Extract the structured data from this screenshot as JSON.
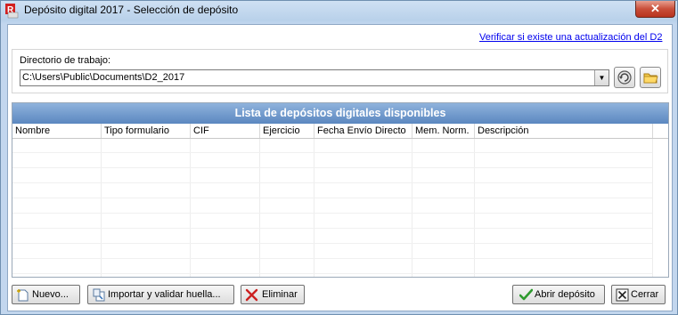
{
  "window": {
    "title": "Depósito digital 2017 - Selección de depósito",
    "close_label": "✕"
  },
  "update_link": "Verificar si existe una actualización del D2",
  "working_dir": {
    "label": "Directorio de trabajo:",
    "value": "C:\\Users\\Public\\Documents\\D2_2017"
  },
  "list": {
    "title": "Lista de depósitos digitales disponibles",
    "columns": [
      "Nombre",
      "Tipo formulario",
      "CIF",
      "Ejercicio",
      "Fecha Envío Directo",
      "Mem. Norm.",
      "Descripción"
    ],
    "rows": []
  },
  "buttons": {
    "new": "Nuevo...",
    "import": "Importar y validar huella...",
    "delete": "Eliminar",
    "open": "Abrir depósito",
    "close": "Cerrar"
  },
  "colors": {
    "header_top": "#8fb3dc",
    "header_bottom": "#5b87c0",
    "link": "#0000ee",
    "delete_x": "#cc2020",
    "open_check": "#2e9a2e"
  }
}
